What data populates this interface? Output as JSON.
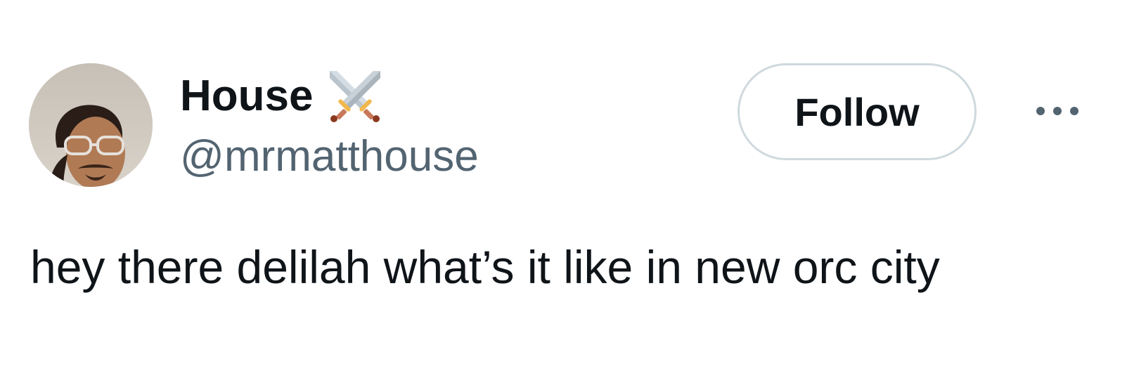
{
  "author": {
    "display_name": "House",
    "name_emoji": "crossed-swords-icon",
    "handle": "@mrmatthouse",
    "avatar": "profile-photo"
  },
  "actions": {
    "follow_label": "Follow",
    "more_icon": "more-horizontal-icon"
  },
  "tweet": {
    "text": "hey there delilah what’s it like in new orc city"
  },
  "colors": {
    "text_primary": "#0f1419",
    "text_secondary": "#536471",
    "button_border": "#cfd9de",
    "background": "#ffffff"
  }
}
